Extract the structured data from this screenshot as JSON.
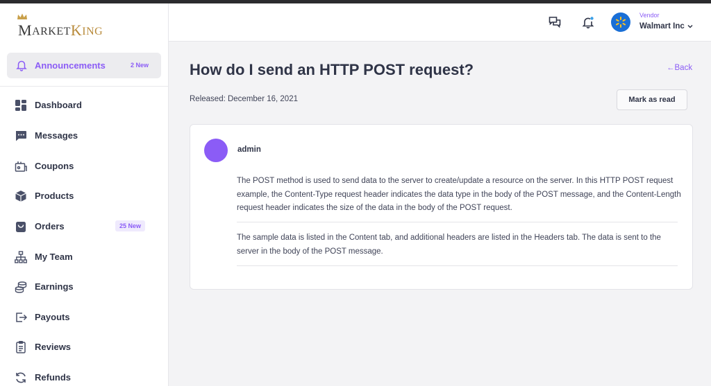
{
  "brand": {
    "logo_part1_initial": "M",
    "logo_part1_rest": "ARKET",
    "logo_part2_initial": "K",
    "logo_part2_rest": "ING"
  },
  "sidebar": {
    "announcements": {
      "label": "Announcements",
      "badge": "2 New",
      "icon": "bell-icon"
    },
    "items": [
      {
        "label": "Dashboard",
        "icon": "dashboard-grid-icon",
        "badge": ""
      },
      {
        "label": "Messages",
        "icon": "chat-bubble-icon",
        "badge": ""
      },
      {
        "label": "Coupons",
        "icon": "gift-card-icon",
        "badge": ""
      },
      {
        "label": "Products",
        "icon": "box-icon",
        "badge": ""
      },
      {
        "label": "Orders",
        "icon": "shopping-bag-icon",
        "badge": "25 New"
      },
      {
        "label": "My Team",
        "icon": "org-chart-icon",
        "badge": ""
      },
      {
        "label": "Earnings",
        "icon": "coins-icon",
        "badge": ""
      },
      {
        "label": "Payouts",
        "icon": "payout-export-icon",
        "badge": ""
      },
      {
        "label": "Reviews",
        "icon": "clipboard-icon",
        "badge": ""
      },
      {
        "label": "Refunds",
        "icon": "refresh-icon",
        "badge": ""
      }
    ]
  },
  "header": {
    "vendor_label": "Vendor",
    "vendor_name": "Walmart Inc"
  },
  "page": {
    "title": "How do I send an HTTP POST request?",
    "back_label": "←Back",
    "released": "Released: December 16, 2021",
    "mark_read_label": "Mark as read"
  },
  "post": {
    "author": "admin",
    "paragraphs": [
      "The POST method is used to send data to the server to create/update a resource on the server. In this HTTP POST request example, the Content-Type request header indicates the data type in the body of the POST message, and the Content-Length request header indicates the size of the data in the body of the POST request.",
      "The sample data is listed in the Content tab, and additional headers are listed in the Headers tab. The data is sent to the server in the body of the POST message."
    ]
  },
  "colors": {
    "accent": "#8b5cf6",
    "text": "#2f3447",
    "background": "#f3f3f5",
    "avatar": "#8b5cf6",
    "walmart_blue": "#1a6fd6"
  }
}
